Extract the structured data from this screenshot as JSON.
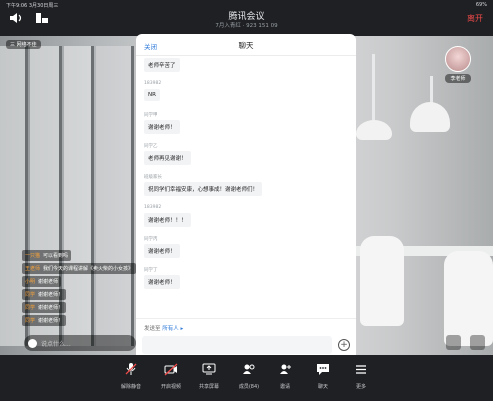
{
  "status": {
    "time": "下午9:06",
    "date": "3月30日周三",
    "battery": "69%"
  },
  "meeting": {
    "title": "腾讯会议",
    "subtitle": "7月入青红 · 923 151 09",
    "leave_label": "离开"
  },
  "video": {
    "network_badge": "三 网络不佳",
    "avatar_name": "李老师"
  },
  "danmaku": [
    {
      "name": "一只猫",
      "text": "可以看到吗"
    },
    {
      "name": "王老师",
      "text": "我们今天的课程讲解《卖火柴的小女孩》"
    },
    {
      "name": "小明",
      "text": "谢谢老师"
    },
    {
      "name": "同学",
      "text": "谢谢老师！"
    },
    {
      "name": "同学",
      "text": "谢谢老师！"
    },
    {
      "name": "同学",
      "text": "谢谢老师！"
    }
  ],
  "say_placeholder": "说点什么...",
  "chat": {
    "close_label": "关闭",
    "title": "聊天",
    "messages": [
      {
        "sender": "",
        "text": "老师辛苦了"
      },
      {
        "sender": "183982",
        "text": "NR"
      },
      {
        "sender": "同学甲",
        "text": "谢谢老师！"
      },
      {
        "sender": "同学乙",
        "text": "老师再见谢谢！"
      },
      {
        "sender": "班级家长",
        "text": "祝同学们幸福安康，心想事成！谢谢老师们！"
      },
      {
        "sender": "183982",
        "text": "谢谢老师！！！"
      },
      {
        "sender": "同学丙",
        "text": "谢谢老师！"
      },
      {
        "sender": "同学丁",
        "text": "谢谢老师！"
      }
    ],
    "send_to_label": "发送至",
    "send_to_target": "所有人 ▸"
  },
  "toolbar": [
    {
      "label": "解除静音",
      "icon": "mic-muted-icon"
    },
    {
      "label": "开启视频",
      "icon": "camera-off-icon"
    },
    {
      "label": "共享屏幕",
      "icon": "share-screen-icon"
    },
    {
      "label": "成员(84)",
      "icon": "members-icon"
    },
    {
      "label": "邀请",
      "icon": "invite-icon"
    },
    {
      "label": "聊天",
      "icon": "chat-icon"
    },
    {
      "label": "更多",
      "icon": "more-icon"
    }
  ],
  "colors": {
    "accent": "#2f7bd9",
    "leave": "#f04a4a",
    "danmaku_name": "#f6a33a"
  }
}
